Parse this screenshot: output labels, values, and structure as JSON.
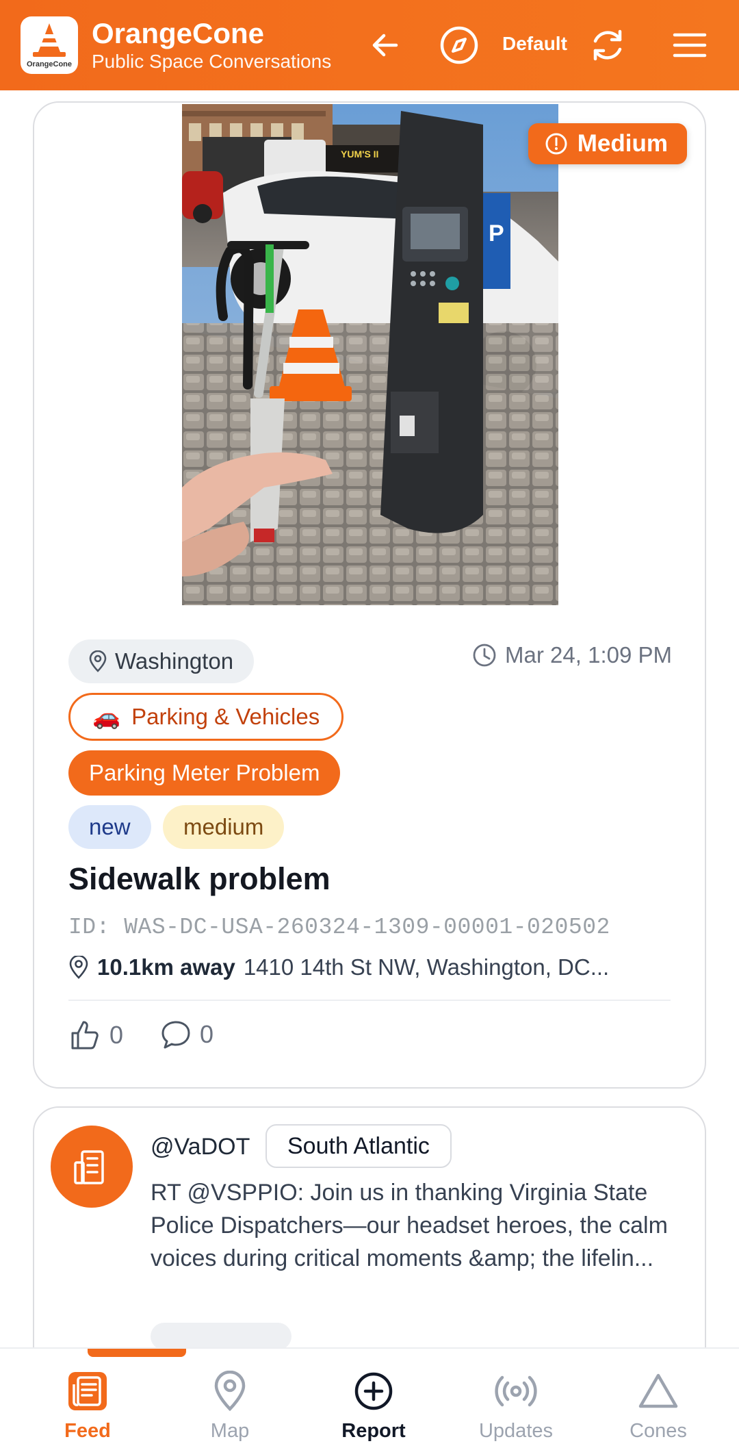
{
  "header": {
    "logo_text": "OrangeCone",
    "title": "OrangeCone",
    "subtitle": "Public Space Conversations",
    "profile_label": "Default",
    "icons": [
      "back-arrow-icon",
      "compass-icon",
      "refresh-icon",
      "menu-icon"
    ]
  },
  "report": {
    "severity": "Medium",
    "location": "Washington",
    "date": "Mar 24, 1:09 PM",
    "category_emoji": "🚗",
    "category": "Parking & Vehicles",
    "subcategory": "Parking Meter Problem",
    "tags": [
      "new",
      "medium"
    ],
    "title": "Sidewalk problem",
    "id": "ID: WAS-DC-USA-260324-1309-00001-020502",
    "distance": "10.1km away",
    "address": "1410 14th St NW, Washington, DC...",
    "likes": "0",
    "comments": "0",
    "colors": {
      "accent": "#f26a1b",
      "tag_new_bg": "#dde8fa",
      "tag_medium_bg": "#fdf1c8"
    }
  },
  "post": {
    "handle": "@VaDOT",
    "region": "South Atlantic",
    "text": "RT @VSPPIO: Join us in thanking Virginia State Police Dispatchers—our headset heroes, the calm voices during critical moments &amp; the lifelin...",
    "avatar_icon": "building-icon"
  },
  "nav": {
    "active": "Feed",
    "items": [
      {
        "label": "Feed",
        "icon": "feed-icon"
      },
      {
        "label": "Map",
        "icon": "map-pin-icon"
      },
      {
        "label": "Report",
        "icon": "plus-circle-icon"
      },
      {
        "label": "Updates",
        "icon": "broadcast-icon"
      },
      {
        "label": "Cones",
        "icon": "cone-triangle-icon"
      }
    ]
  }
}
